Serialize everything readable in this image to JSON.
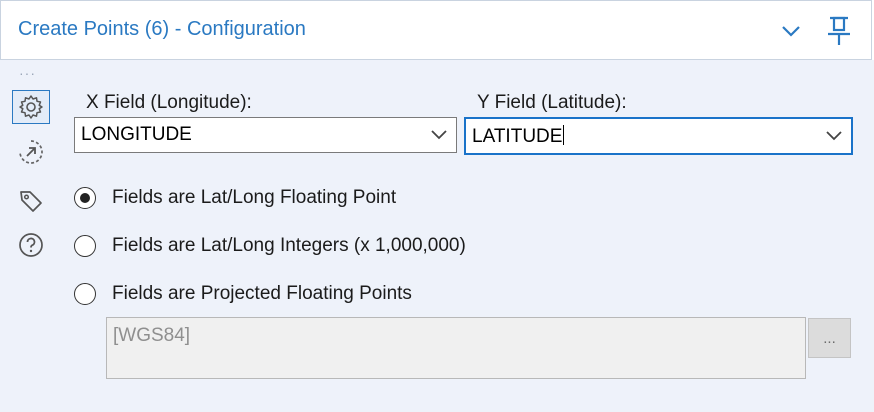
{
  "header": {
    "title": "Create Points (6) - Configuration",
    "collapse_icon": "chevron-down-icon",
    "pin_icon": "pin-icon"
  },
  "sidebar": {
    "overflow_label": "···",
    "items": [
      {
        "icon": "gear-icon",
        "active": true
      },
      {
        "icon": "circle-arrow-icon",
        "active": false
      },
      {
        "icon": "tag-icon",
        "active": false
      },
      {
        "icon": "help-icon",
        "active": false
      }
    ]
  },
  "form": {
    "x_field": {
      "label": "X Field (Longitude):",
      "value": "LONGITUDE"
    },
    "y_field": {
      "label": "Y Field (Latitude):",
      "value": "LATITUDE"
    },
    "options": [
      {
        "label": "Fields are Lat/Long Floating Point",
        "selected": true
      },
      {
        "label": "Fields are Lat/Long Integers (x 1,000,000)",
        "selected": false
      },
      {
        "label": "Fields are Projected Floating Points",
        "selected": false
      }
    ],
    "projection": {
      "value": "[WGS84]",
      "browse_label": "..."
    }
  },
  "colors": {
    "accent": "#2a79c2",
    "panel_background": "#eef2fa",
    "focus_border": "#1a73c9"
  }
}
